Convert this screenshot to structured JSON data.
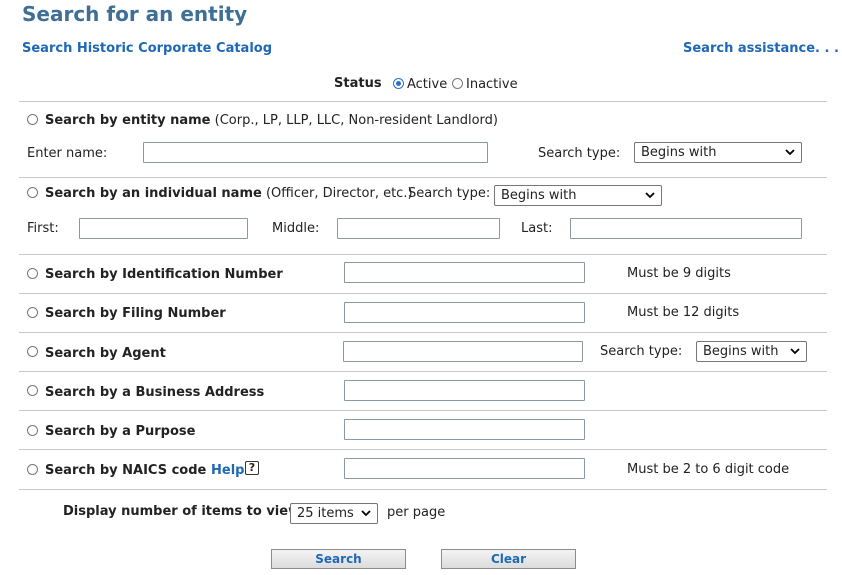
{
  "header": {
    "title": "Search for an entity",
    "historic_link": "Search Historic Corporate Catalog",
    "assist_link": "Search assistance. . ."
  },
  "status": {
    "label": "Status",
    "active": "Active",
    "inactive": "Inactive",
    "selected": "Active"
  },
  "entity": {
    "label": "Search by entity name",
    "hint": "(Corp., LP, LLP, LLC, Non-resident Landlord)",
    "enter_name_label": "Enter name:",
    "enter_name_value": "",
    "search_type_label": "Search type:",
    "search_type_value": "Begins with"
  },
  "individual": {
    "label": "Search by an individual name",
    "hint": "(Officer, Director, etc.)",
    "search_type_label": "Search type:",
    "search_type_value": "Begins with",
    "first_label": "First:",
    "middle_label": "Middle:",
    "last_label": "Last:"
  },
  "id_number": {
    "label": "Search by Identification Number",
    "note": "Must be 9 digits",
    "value": ""
  },
  "filing_number": {
    "label": "Search by Filing Number",
    "note": "Must be 12 digits",
    "value": ""
  },
  "agent": {
    "label": "Search by Agent",
    "search_type_label": "Search type:",
    "search_type_value": "Begins with",
    "value": ""
  },
  "address": {
    "label": "Search by a Business Address",
    "value": ""
  },
  "purpose": {
    "label": "Search by a Purpose",
    "value": ""
  },
  "naics": {
    "label": "Search by NAICS code",
    "help": "Help",
    "help_icon": "?",
    "note": "Must be 2 to 6 digit code",
    "value": ""
  },
  "display": {
    "label": "Display number of items to view:",
    "value": "25 items",
    "suffix": "per page"
  },
  "buttons": {
    "search": "Search",
    "clear": "Clear"
  }
}
